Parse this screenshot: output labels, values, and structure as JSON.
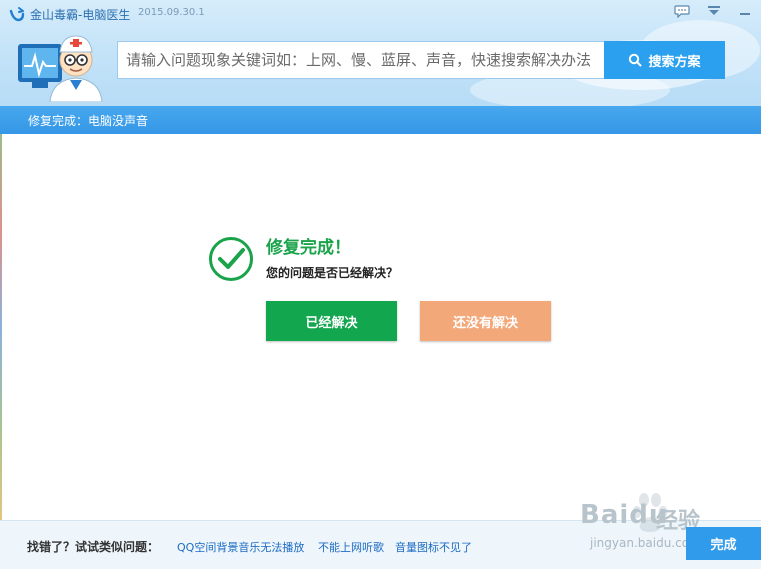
{
  "app": {
    "title": "金山毒霸-电脑医生",
    "version": "2015.09.30.1"
  },
  "search": {
    "placeholder": "请输入问题现象关键词如：上网、慢、蓝屏、声音，快速搜索解决办法",
    "button_label": "搜索方案"
  },
  "status": {
    "text": "修复完成：电脑没声音"
  },
  "result": {
    "title": "修复完成！",
    "question": "您的问题是否已经解决？",
    "solved_label": "已经解决",
    "unsolved_label": "还没有解决"
  },
  "footer": {
    "label": "找错了？试试类似问题：",
    "links": [
      "QQ空间背景音乐无法播放",
      "不能上网听歌",
      "音量图标不见了"
    ],
    "done_label": "完成"
  },
  "watermark": {
    "brand": "Baidu",
    "brand_cn": "经验",
    "url": "jingyan.baidu.com"
  },
  "colors": {
    "accent": "#2aa0ee",
    "success": "#12a64f",
    "warning": "#f3a87a",
    "status_bar": "#3d9fe9"
  },
  "icons": {
    "app_logo": "duba-logo-icon",
    "chat": "chat-bubble-icon",
    "menu": "dropdown-menu-icon",
    "minimize": "minimize-icon",
    "search": "search-icon",
    "check": "check-circle-icon",
    "avatar": "doctor-avatar-icon"
  }
}
